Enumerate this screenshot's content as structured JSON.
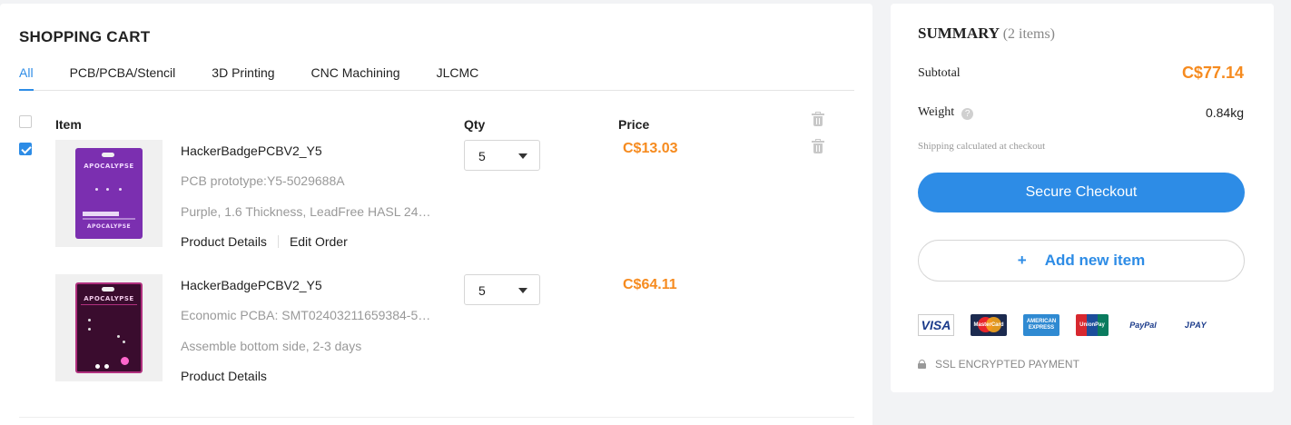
{
  "cart": {
    "title": "SHOPPING CART",
    "tabs": [
      {
        "label": "All",
        "active": true
      },
      {
        "label": "PCB/PCBA/Stencil",
        "active": false
      },
      {
        "label": "3D Printing",
        "active": false
      },
      {
        "label": "CNC Machining",
        "active": false
      },
      {
        "label": "JLCMC",
        "active": false
      }
    ],
    "columns": {
      "item": "Item",
      "qty": "Qty",
      "price": "Price"
    },
    "select_all_checked": false,
    "items": [
      {
        "checked": true,
        "name": "HackerBadgePCBV2_Y5",
        "line1": "PCB prototype:Y5-5029688A",
        "line2": "Purple, 1.6 Thickness, LeadFree HASL 24…",
        "links": [
          "Product Details",
          "Edit Order"
        ],
        "qty": "5",
        "price": "C$13.03",
        "board_text": "APOCALYPSE",
        "board_color": "#7b2fb0"
      },
      {
        "checked": false,
        "name": "HackerBadgePCBV2_Y5",
        "line1": "Economic PCBA: SMT02403211659384-5…",
        "line2": "Assemble bottom side, 2-3 days",
        "links": [
          "Product Details"
        ],
        "qty": "5",
        "price": "C$64.11",
        "board_text": "APOCALYPSE",
        "board_color": "#3a0c2e"
      }
    ]
  },
  "summary": {
    "title": "SUMMARY",
    "count": "(2 items)",
    "subtotal_label": "Subtotal",
    "subtotal_value": "C$77.14",
    "weight_label": "Weight",
    "weight_value": "0.84kg",
    "shipping_note": "Shipping calculated at checkout",
    "checkout_label": "Secure Checkout",
    "add_label": "Add new item",
    "add_icon": "+",
    "payments": {
      "visa": "VISA",
      "mastercard": "MasterCard",
      "amex": "AMERICAN EXPRESS",
      "unionpay": "UnionPay",
      "paypal": "PayPal",
      "jpay": "JPAY"
    },
    "ssl_label": "SSL ENCRYPTED PAYMENT"
  },
  "colors": {
    "accent": "#2d8ce6",
    "price": "#f68b1f"
  }
}
